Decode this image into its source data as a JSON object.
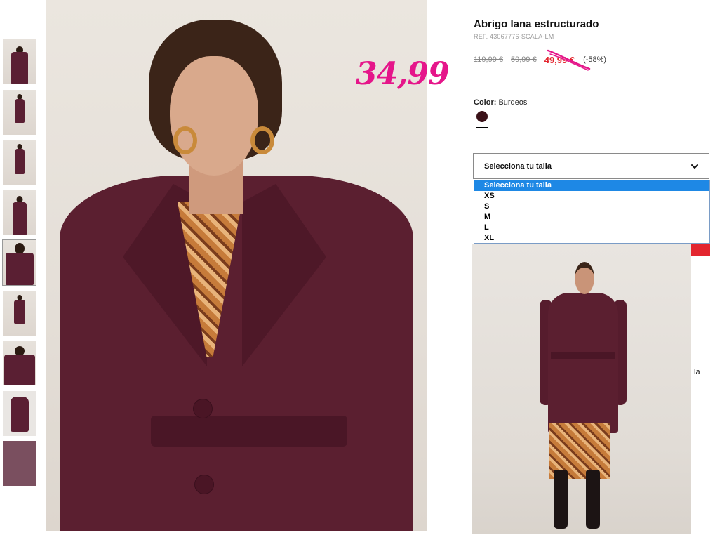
{
  "product": {
    "title": "Abrigo lana estructurado",
    "ref": "REF. 43067776-SCALA-LM",
    "prices": {
      "original": "119,99 €",
      "previous": "59,99 €",
      "current": "49,99 €",
      "discount": "(-58%)"
    },
    "annotation_price": "34,99",
    "color": {
      "label": "Color:",
      "value": "Burdeos",
      "swatch_hex": "#3a1118"
    }
  },
  "size_select": {
    "label": "Selecciona tu talla",
    "options": [
      "Selecciona tu talla",
      "XS",
      "S",
      "M",
      "L",
      "XL"
    ],
    "selected_index": 0
  },
  "side_text": "la",
  "colors": {
    "price_red": "#e3262f",
    "annotation_pink": "#e5168a",
    "coat_burgundy": "#5b1f30",
    "dropdown_highlight": "#1e88e5"
  },
  "icons": {
    "select_chevron": "chevron-down-icon"
  }
}
